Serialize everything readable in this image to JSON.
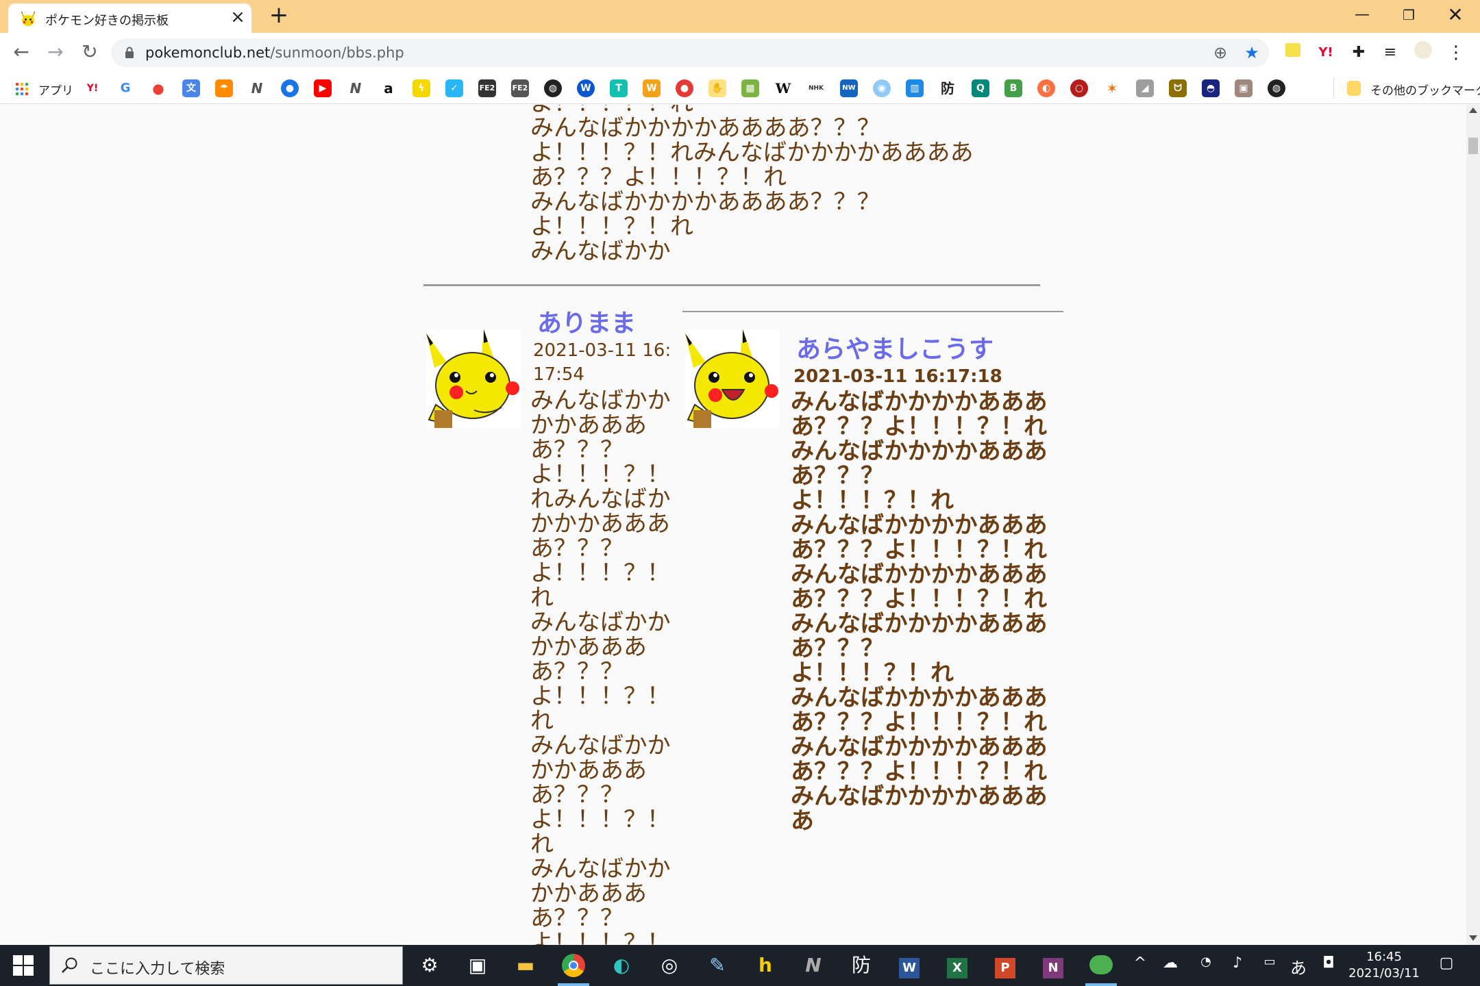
{
  "browser": {
    "tab_title": "ポケモン好きの掲示板",
    "url_host": "pokemonclub.net",
    "url_path": "/sunmoon/bbs.php",
    "bookmarks": {
      "apps_label": "アプリ",
      "other_label": "その他のブックマーク"
    }
  },
  "page": {
    "top_message": "よ！！！？！れ\nみんなばかかかかああああ？？？\nよ！！！？！れみんなばかかかかああああ\nあ？？？よ！！！？！れ\nみんなばかかかかああああ？？？\nよ！！！？！れ\nみんなばかか",
    "post1": {
      "name": "ありまま",
      "date": "2021-03-11 16:17:54",
      "body": "みんなばかかかかああああ？？？\nよ！！！？！れみんなばかかかかああああ？？？\nよ！！！？！れ\nみんなばかかかかああああ？？？\nよ！！！？！れ\nみんなばかかかかああああ？？？\nよ！！！？！れ\nみんなばかかかかああああ？？？\nよ！！！？！"
    },
    "post2": {
      "name": "あらやましこうす",
      "date": "2021-03-11 16:17:18",
      "body": "みんなばかかかかああああ？？？よ！！！？！れみんなばかかかかああああ？？？\nよ！！！？！れ\nみんなばかかかかああああ？？？よ！！！？！れ\nみんなばかかかかああああ？？？よ！！！？！れみんなばかかかかああああ？？？\nよ！！！？！れ\nみんなばかかかかああああ？？？よ！！！？！れ\nみんなばかかかかああああ？？？よ！！！？！れ\nみんなばかかかかああああ"
    }
  },
  "taskbar": {
    "search_placeholder": "ここに入力して検索",
    "ime": "あ",
    "time": "16:45",
    "date": "2021/03/11"
  }
}
